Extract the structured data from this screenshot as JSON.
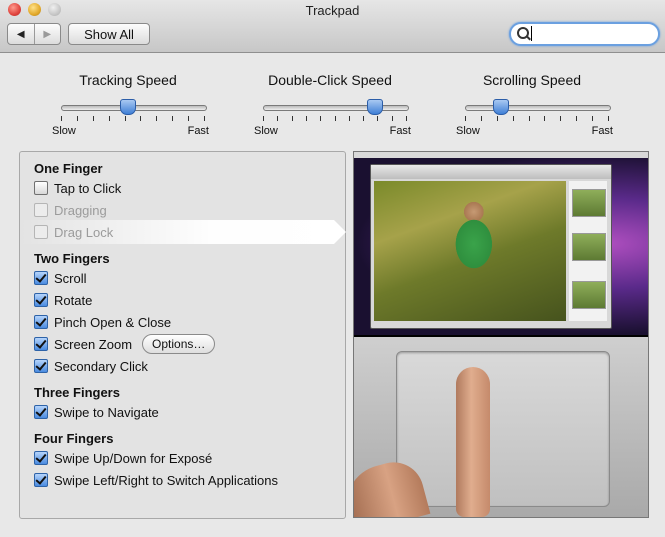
{
  "window": {
    "title": "Trackpad"
  },
  "toolbar": {
    "back_icon": "◀",
    "forward_icon": "▶",
    "show_all_label": "Show All",
    "search": {
      "value": "",
      "placeholder": ""
    }
  },
  "sliders": [
    {
      "label": "Tracking Speed",
      "min_label": "Slow",
      "max_label": "Fast",
      "value": 0.46,
      "ticks": 10
    },
    {
      "label": "Double-Click Speed",
      "min_label": "Slow",
      "max_label": "Fast",
      "value": 0.77,
      "ticks": 11
    },
    {
      "label": "Scrolling Speed",
      "min_label": "Slow",
      "max_label": "Fast",
      "value": 0.24,
      "ticks": 10
    }
  ],
  "options": {
    "one_finger": {
      "heading": "One Finger",
      "tap_to_click": {
        "label": "Tap to Click",
        "checked": false
      },
      "dragging": {
        "label": "Dragging",
        "checked": false,
        "enabled": false
      },
      "drag_lock": {
        "label": "Drag Lock",
        "checked": false,
        "enabled": false
      }
    },
    "two_fingers": {
      "heading": "Two Fingers",
      "scroll": {
        "label": "Scroll",
        "checked": true
      },
      "rotate": {
        "label": "Rotate",
        "checked": true
      },
      "pinch": {
        "label": "Pinch Open & Close",
        "checked": true
      },
      "screen_zoom": {
        "label": "Screen Zoom",
        "checked": true,
        "options_label": "Options…"
      },
      "secondary_click": {
        "label": "Secondary Click",
        "checked": true
      }
    },
    "three_fingers": {
      "heading": "Three Fingers",
      "swipe_navigate": {
        "label": "Swipe to Navigate",
        "checked": true
      }
    },
    "four_fingers": {
      "heading": "Four Fingers",
      "swipe_expose": {
        "label": "Swipe Up/Down for Exposé",
        "checked": true
      },
      "swipe_apps": {
        "label": "Swipe Left/Right to Switch Applications",
        "checked": true
      }
    }
  },
  "icons": {
    "search": "magnifier-icon",
    "close": "close-button-icon",
    "minimize": "minimize-button-icon",
    "zoom": "zoom-button-icon"
  },
  "colors": {
    "accent": "#3f7fd6",
    "window_bg": "#e8e8e8"
  }
}
